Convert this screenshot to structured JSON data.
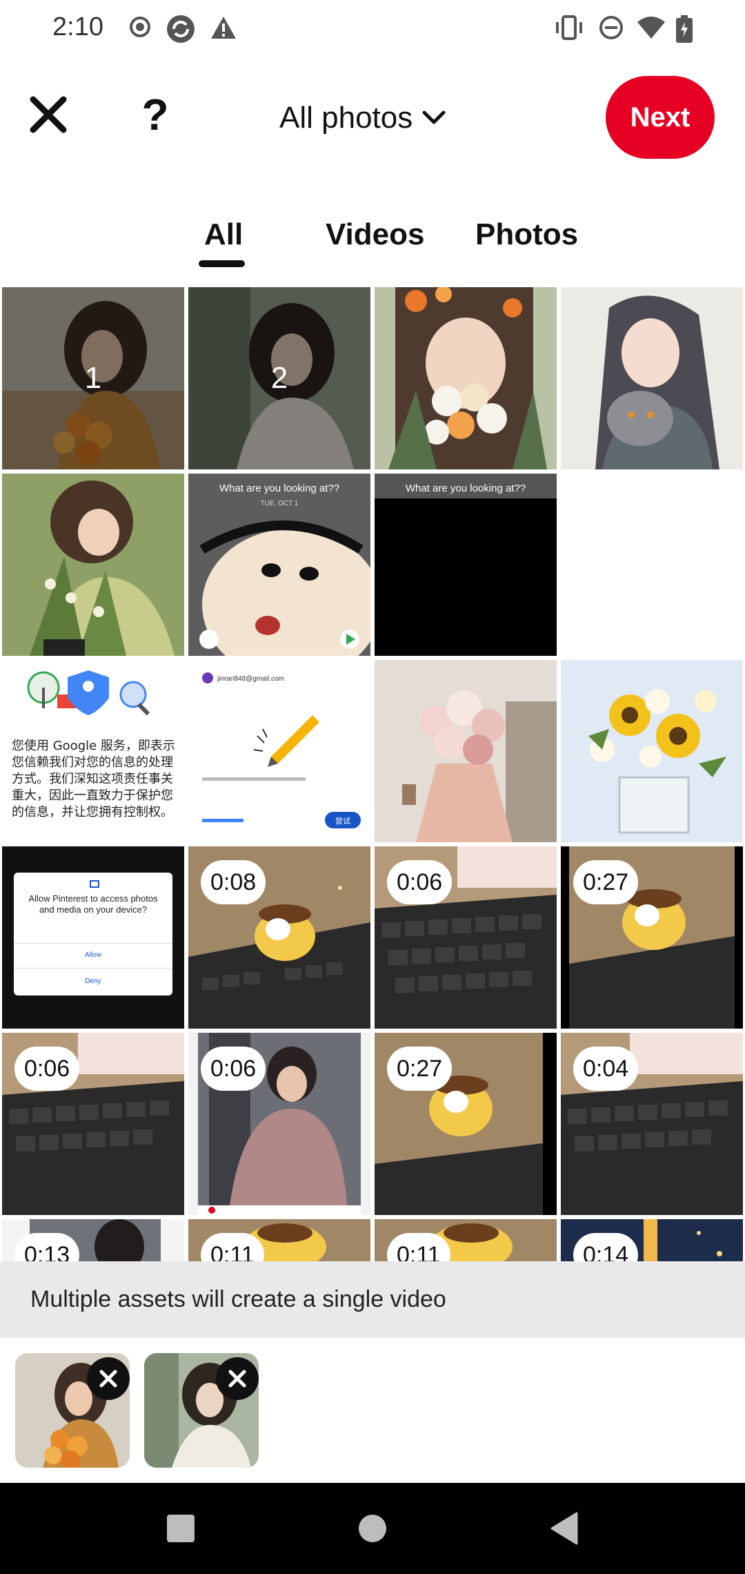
{
  "status_bar": {
    "time": "2:10",
    "icons": [
      "record-icon",
      "sync-icon",
      "warning-icon",
      "vibrate-icon",
      "dnd-icon",
      "wifi-icon",
      "battery-icon"
    ]
  },
  "header": {
    "album_label": "All photos",
    "next_label": "Next",
    "help_label": "?"
  },
  "tabs": [
    {
      "label": "All",
      "selected": true
    },
    {
      "label": "Videos",
      "selected": false
    },
    {
      "label": "Photos",
      "selected": false
    }
  ],
  "grid": {
    "cells": [
      {
        "kind": "image",
        "desc": "woman-with-orange-flowers",
        "selection_number": "1"
      },
      {
        "kind": "image",
        "desc": "woman-in-white-shirt",
        "selection_number": "2"
      },
      {
        "kind": "image",
        "desc": "girl-behind-flower-bouquet"
      },
      {
        "kind": "image",
        "desc": "girl-with-grey-cat"
      },
      {
        "kind": "image",
        "desc": "woman-holding-plants"
      },
      {
        "kind": "screenshot",
        "desc": "lock-screen-cartoon",
        "caption": "What are you looking at??",
        "subcaption": "TUE, OCT 1"
      },
      {
        "kind": "screenshot",
        "desc": "lock-screen-black",
        "caption": "What are you looking at??"
      },
      {
        "kind": "empty"
      },
      {
        "kind": "screenshot",
        "desc": "google-privacy-screen",
        "text_lines": [
          "您使用 Google 服务，即表示",
          "您信赖我们对您的信息的处理",
          "方式。我们深知这项责任事关",
          "重大，因此一直致力于保护您",
          "的信息，并让您拥有控制权。"
        ]
      },
      {
        "kind": "screenshot",
        "desc": "google-account-screen",
        "account": "jinran848@gmail.com",
        "button": "尝试"
      },
      {
        "kind": "image",
        "desc": "pink-flower-bouquet"
      },
      {
        "kind": "image",
        "desc": "sunflower-vase"
      },
      {
        "kind": "screenshot",
        "desc": "permission-dialog",
        "dialog_text": "Allow Pinterest to access photos and media on your device?",
        "allow": "Allow",
        "deny": "Deny"
      },
      {
        "kind": "video",
        "desc": "toy-on-keyboard",
        "duration": "0:08"
      },
      {
        "kind": "video",
        "desc": "keyboard-closeup",
        "duration": "0:06"
      },
      {
        "kind": "video",
        "desc": "toy-on-keyboard",
        "duration": "0:27"
      },
      {
        "kind": "video",
        "desc": "keyboard-closeup",
        "duration": "0:06"
      },
      {
        "kind": "video",
        "desc": "man-in-pink-jacket",
        "duration": "0:06"
      },
      {
        "kind": "video",
        "desc": "toy-on-keyboard",
        "duration": "0:27"
      },
      {
        "kind": "video",
        "desc": "keyboard-closeup",
        "duration": "0:04"
      },
      {
        "kind": "video",
        "desc": "person-partial",
        "duration": "0:13"
      },
      {
        "kind": "video",
        "desc": "toy-partial",
        "duration": "0:11"
      },
      {
        "kind": "video",
        "desc": "toy-partial",
        "duration": "0:11"
      },
      {
        "kind": "video",
        "desc": "night-scene",
        "duration": "0:14"
      }
    ]
  },
  "banner": {
    "text": "Multiple assets will create a single video"
  },
  "tray": {
    "items": [
      {
        "desc": "woman-with-orange-flowers"
      },
      {
        "desc": "woman-in-white-shirt"
      }
    ]
  },
  "colors": {
    "accent": "#e60023",
    "banner_bg": "#e9e9e9",
    "nav_bg": "#000000"
  }
}
